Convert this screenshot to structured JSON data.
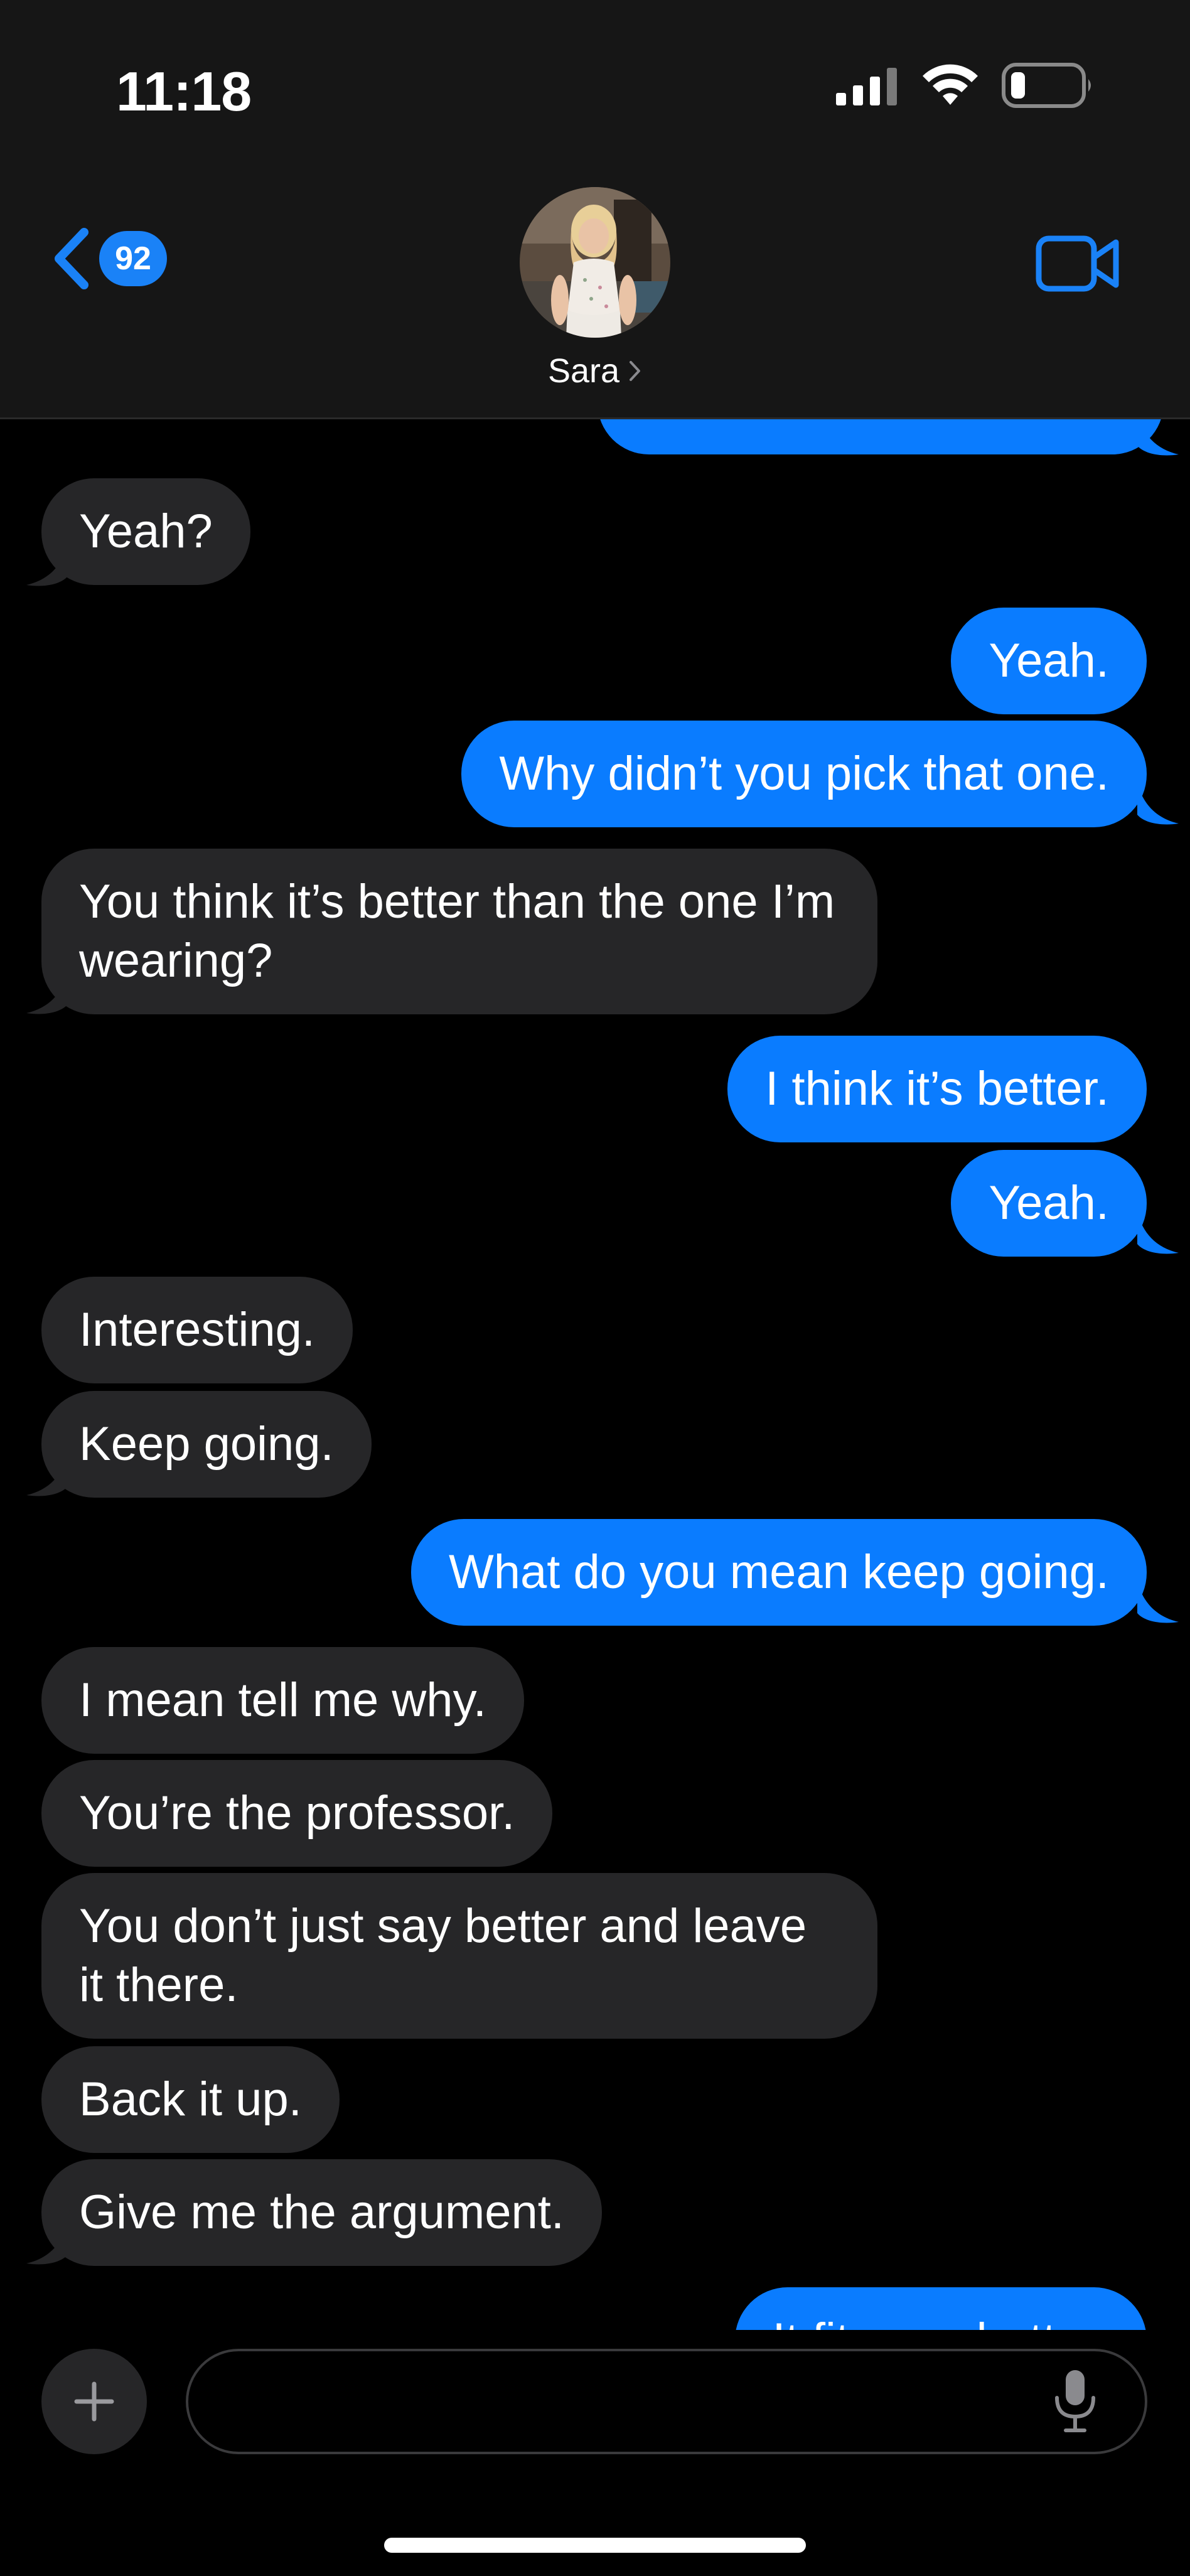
{
  "status_bar": {
    "time": "11:18"
  },
  "header": {
    "unread_count": "92",
    "contact_name": "Sara",
    "back_icon": "chevron-left-icon",
    "video_icon": "video-camera-icon"
  },
  "messages": [
    {
      "id": "m0",
      "direction": "out",
      "text": ""
    },
    {
      "id": "m1",
      "direction": "in",
      "text": "Yeah?"
    },
    {
      "id": "m2",
      "direction": "out",
      "text": "Yeah."
    },
    {
      "id": "m3",
      "direction": "out",
      "text": "Why didn’t you pick that one."
    },
    {
      "id": "m4",
      "direction": "in",
      "text": "You think it’s better than the one I’m wearing?"
    },
    {
      "id": "m5",
      "direction": "out",
      "text": "I think it’s better."
    },
    {
      "id": "m6",
      "direction": "out",
      "text": "Yeah."
    },
    {
      "id": "m7",
      "direction": "in",
      "text": "Interesting."
    },
    {
      "id": "m8",
      "direction": "in",
      "text": "Keep going."
    },
    {
      "id": "m9",
      "direction": "out",
      "text": "What do you mean keep going."
    },
    {
      "id": "m10",
      "direction": "in",
      "text": "I mean tell me why."
    },
    {
      "id": "m11",
      "direction": "in",
      "text": "You’re the professor."
    },
    {
      "id": "m12",
      "direction": "in",
      "text": "You don’t just say better and leave it there."
    },
    {
      "id": "m13",
      "direction": "in",
      "text": "Back it up."
    },
    {
      "id": "m14",
      "direction": "in",
      "text": "Give me the argument."
    },
    {
      "id": "m15",
      "direction": "out",
      "text": "It fits you better."
    }
  ],
  "composer": {
    "value": "",
    "placeholder": "",
    "plus_icon": "plus-icon",
    "mic_icon": "microphone-icon"
  },
  "colors": {
    "incoming_bubble": "#262628",
    "outgoing_bubble": "#0a7cff",
    "accent": "#1a82f7",
    "header_bg": "#161616",
    "background": "#000000"
  }
}
